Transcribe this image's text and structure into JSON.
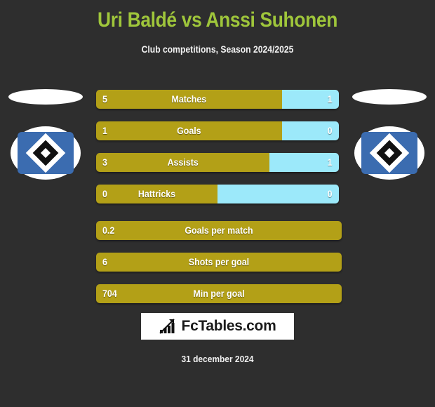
{
  "header": {
    "title": "Uri Baldé vs Anssi Suhonen",
    "subtitle": "Club competitions, Season 2024/2025",
    "title_color": "#9fc63b"
  },
  "badges": {
    "home": {
      "name": "home-club-badge",
      "crest_color": "#3b6cb0"
    },
    "away": {
      "name": "away-club-badge",
      "crest_color": "#3b6cb0"
    }
  },
  "colors": {
    "background": "#2e2e2e",
    "home_bar": "#b3a017",
    "away_bar": "#9ce9fa",
    "logo_background": "#ffffff"
  },
  "chart_data": {
    "type": "bar",
    "title": "Uri Baldé vs Anssi Suhonen",
    "subtitle": "Club competitions, Season 2024/2025",
    "orientation": "horizontal-diverging",
    "series": [
      {
        "name": "Uri Baldé",
        "color": "#b3a017",
        "side": "left"
      },
      {
        "name": "Anssi Suhonen",
        "color": "#9ce9fa",
        "side": "right"
      }
    ],
    "categories": [
      "Matches",
      "Goals",
      "Assists",
      "Hattricks",
      "Goals per match",
      "Shots per goal",
      "Min per goal"
    ],
    "rows": [
      {
        "label": "Matches",
        "home": "5",
        "away": "1",
        "home_pct": 76.5,
        "split": true
      },
      {
        "label": "Goals",
        "home": "1",
        "away": "0",
        "home_pct": 76.5,
        "split": true
      },
      {
        "label": "Assists",
        "home": "3",
        "away": "1",
        "home_pct": 71.5,
        "split": true
      },
      {
        "label": "Hattricks",
        "home": "0",
        "away": "0",
        "home_pct": 50.0,
        "split": true
      },
      {
        "label": "Goals per match",
        "home": "0.2",
        "away": "",
        "home_pct": 100,
        "split": false
      },
      {
        "label": "Shots per goal",
        "home": "6",
        "away": "",
        "home_pct": 100,
        "split": false
      },
      {
        "label": "Min per goal",
        "home": "704",
        "away": "",
        "home_pct": 100,
        "split": false
      }
    ]
  },
  "footer": {
    "logo_text": "FcTables.com",
    "logo_icon": "bar-chart-icon",
    "date": "31 december 2024"
  }
}
